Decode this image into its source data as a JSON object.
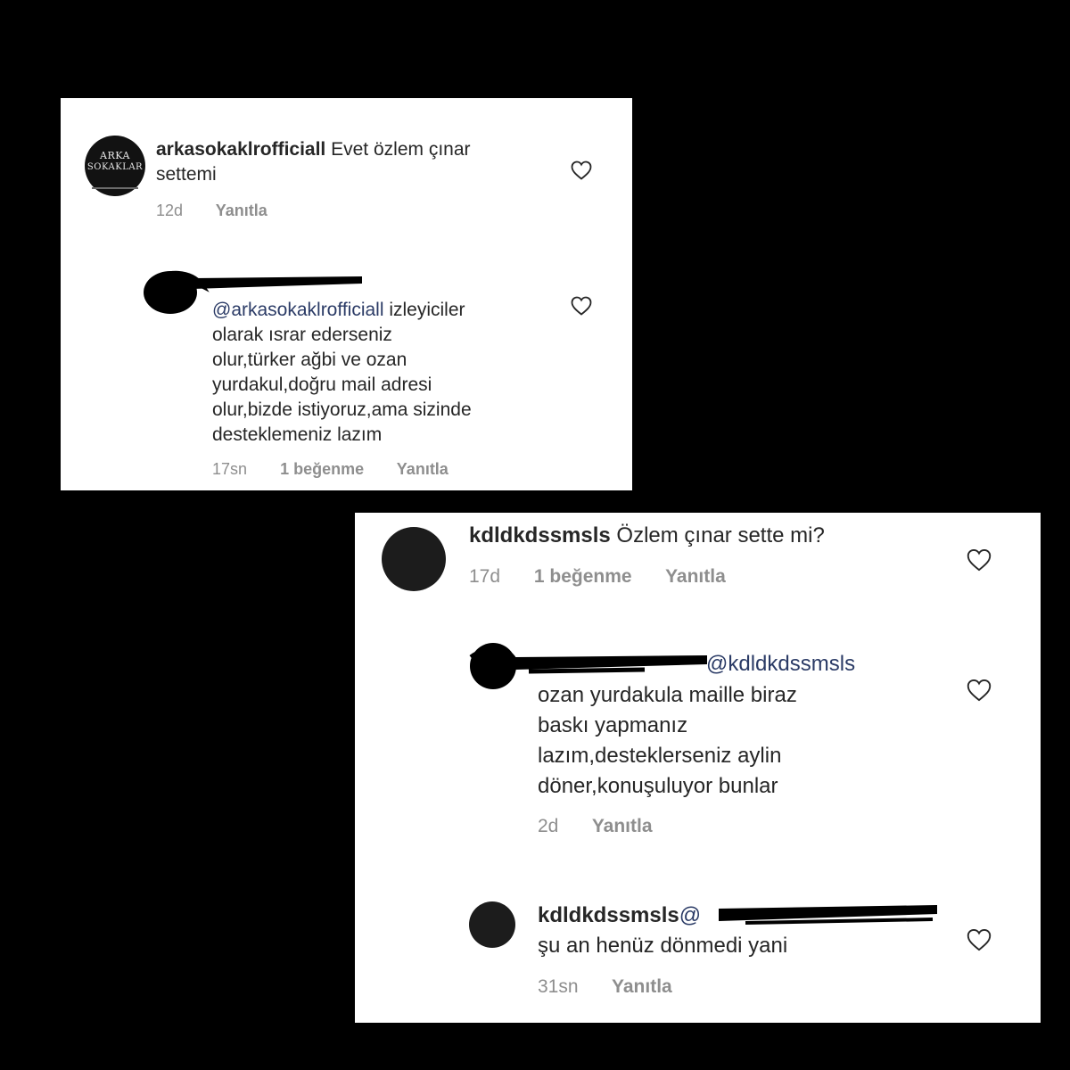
{
  "panel1": {
    "comment": {
      "avatar_logo_top": "ARKA",
      "avatar_logo_bottom": "SOKAKLAR",
      "username": "arkasokaklrofficiall",
      "text_line1": "Evet özlem çınar",
      "text_line2": "settemi",
      "time": "12d",
      "reply_label": "Yanıtla",
      "like_icon": "heart-outline-icon"
    },
    "reply": {
      "username_redacted": true,
      "mention": "@arkasokaklrofficiall",
      "lines": [
        "izleyiciler",
        "olarak ısrar ederseniz",
        "olur,türker ağbi ve ozan",
        "yurdakul,doğru mail adresi",
        "olur,bizde istiyoruz,ama sizinde",
        "desteklemeniz lazım"
      ],
      "time": "17sn",
      "likes": "1 beğenme",
      "reply_label": "Yanıtla",
      "like_icon": "heart-outline-icon"
    }
  },
  "panel2": {
    "comment": {
      "username": "kdldkdssmsls",
      "text": "Özlem çınar sette mi?",
      "time": "17d",
      "likes": "1 beğenme",
      "reply_label": "Yanıtla",
      "like_icon": "heart-outline-icon"
    },
    "reply": {
      "username_redacted": true,
      "mention": "@kdldkdssmsls",
      "lines": [
        "ozan yurdakula maille biraz",
        "baskı yapmanız",
        "lazım,desteklerseniz aylin",
        "döner,konuşuluyor bunlar"
      ],
      "time": "2d",
      "reply_label": "Yanıtla",
      "like_icon": "heart-outline-icon"
    },
    "reply2": {
      "username": "kdldkdssmsls",
      "mention_prefix": "@",
      "text": "şu an henüz dönmedi yani",
      "time": "31sn",
      "reply_label": "Yanıtla",
      "like_icon": "heart-outline-icon"
    }
  },
  "colors": {
    "background": "#000000",
    "card": "#ffffff",
    "text": "#262626",
    "meta": "#8e8e8e",
    "mention": "#2b3b66",
    "redaction": "#000000"
  }
}
